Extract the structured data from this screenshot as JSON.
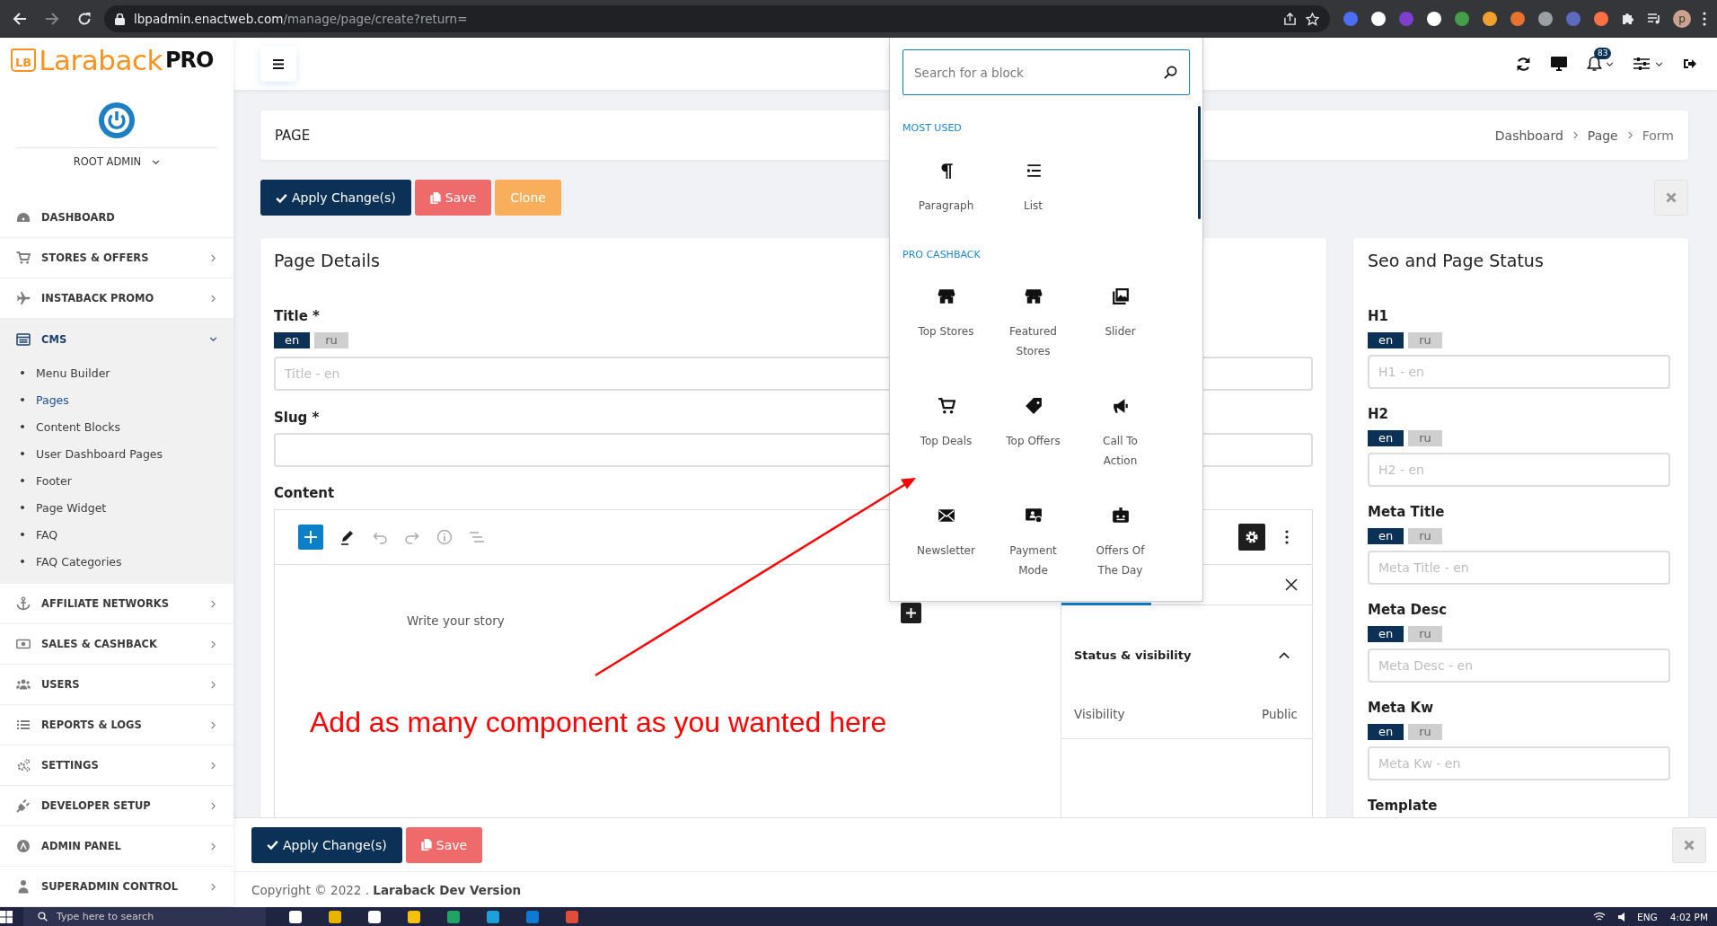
{
  "browser": {
    "url_domain": "lbpadmin.enactweb.com",
    "url_path": "/manage/page/create?return=",
    "profile": "p"
  },
  "sidebar": {
    "logo_mark": "LB",
    "brand": "Laraback",
    "brand_suffix": "PRO",
    "user": "ROOT ADMIN",
    "items": [
      {
        "label": "DASHBOARD",
        "kind": "link"
      },
      {
        "label": "STORES & OFFERS",
        "kind": "group",
        "expanded": false
      },
      {
        "label": "INSTABACK PROMO",
        "kind": "group",
        "expanded": false
      },
      {
        "label": "CMS",
        "kind": "group",
        "expanded": true,
        "children": [
          {
            "label": "Menu Builder",
            "selected": false
          },
          {
            "label": "Pages",
            "selected": true
          },
          {
            "label": "Content Blocks",
            "selected": false
          },
          {
            "label": "User Dashboard Pages",
            "selected": false
          },
          {
            "label": "Footer",
            "selected": false
          },
          {
            "label": "Page Widget",
            "selected": false
          },
          {
            "label": "FAQ",
            "selected": false
          },
          {
            "label": "FAQ Categories",
            "selected": false
          }
        ]
      },
      {
        "label": "AFFILIATE NETWORKS",
        "kind": "group",
        "expanded": false
      },
      {
        "label": "SALES & CASHBACK",
        "kind": "group",
        "expanded": false
      },
      {
        "label": "USERS",
        "kind": "group",
        "expanded": false
      },
      {
        "label": "REPORTS & LOGS",
        "kind": "group",
        "expanded": false
      },
      {
        "label": "SETTINGS",
        "kind": "group",
        "expanded": false
      },
      {
        "label": "DEVELOPER SETUP",
        "kind": "group",
        "expanded": false
      },
      {
        "label": "ADMIN PANEL",
        "kind": "group",
        "expanded": false
      },
      {
        "label": "SUPERADMIN CONTROL",
        "kind": "group",
        "expanded": false
      }
    ]
  },
  "header": {
    "notification_count": "83"
  },
  "page_header": {
    "title": "PAGE",
    "breadcrumb": [
      {
        "label": "Dashboard",
        "kind": "link"
      },
      {
        "label": "Page",
        "kind": "link"
      },
      {
        "label": "Form",
        "kind": "current"
      }
    ]
  },
  "actions": [
    {
      "label": "Apply Change(s)",
      "kind": "primary"
    },
    {
      "label": "Save",
      "kind": "danger"
    },
    {
      "label": "Clone",
      "kind": "warning"
    }
  ],
  "page_details": {
    "title": "Page Details",
    "fields": [
      {
        "label": "Title *",
        "langs": [
          {
            "label": "en",
            "selected": true
          },
          {
            "label": "ru",
            "selected": false
          }
        ],
        "placeholder": "Title - en"
      },
      {
        "label": "Slug *"
      }
    ],
    "content": {
      "label": "Content",
      "placeholder": "Write your story",
      "settings": {
        "section": "Status & visibility",
        "expanded": true,
        "rows": [
          {
            "label": "Visibility",
            "value": "Public"
          }
        ]
      }
    }
  },
  "inserter": {
    "placeholder": "Search for a block",
    "groups": [
      {
        "title": "MOST USED",
        "blocks": [
          "Paragraph",
          "List"
        ]
      },
      {
        "title": "PRO CASHBACK",
        "blocks": [
          "Top Stores",
          "Featured Stores",
          "Slider",
          "Top Deals",
          "Top Offers",
          "Call To Action",
          "Newsletter",
          "Payment Mode",
          "Offers Of The Day"
        ]
      }
    ]
  },
  "seo": {
    "title": "Seo and Page Status",
    "fields": [
      {
        "label": "H1",
        "langs": [
          {
            "label": "en",
            "selected": true
          },
          {
            "label": "ru",
            "selected": false
          }
        ],
        "placeholder": "H1 - en"
      },
      {
        "label": "H2",
        "langs": [
          {
            "label": "en",
            "selected": true
          },
          {
            "label": "ru",
            "selected": false
          }
        ],
        "placeholder": "H2 - en"
      },
      {
        "label": "Meta Title",
        "langs": [
          {
            "label": "en",
            "selected": true
          },
          {
            "label": "ru",
            "selected": false
          }
        ],
        "placeholder": "Meta Title - en"
      },
      {
        "label": "Meta Desc",
        "langs": [
          {
            "label": "en",
            "selected": true
          },
          {
            "label": "ru",
            "selected": false
          }
        ],
        "placeholder": "Meta Desc - en"
      },
      {
        "label": "Meta Kw",
        "langs": [
          {
            "label": "en",
            "selected": true
          },
          {
            "label": "ru",
            "selected": false
          }
        ],
        "placeholder": "Meta Kw - en"
      },
      {
        "label": "Template"
      }
    ]
  },
  "footer_actions": [
    {
      "label": "Apply Change(s)",
      "kind": "primary"
    },
    {
      "label": "Save",
      "kind": "danger"
    }
  ],
  "copyright": "Copyright © 2022 . **Laraback Dev Version**",
  "annotation": {
    "text": "Add as many component as you wanted here"
  },
  "taskbar": {
    "search_placeholder": "Type here to search",
    "language": "ENG",
    "time": "4:02 PM"
  }
}
